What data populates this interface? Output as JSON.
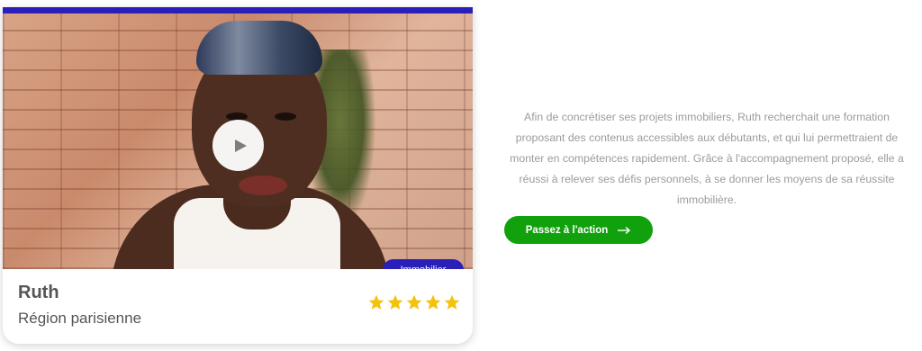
{
  "card": {
    "name": "Ruth",
    "region": "Région parisienne",
    "badge": "Immobilier",
    "rating": 5,
    "accent_color": "#2a1fb8",
    "star_color": "#f4c20d"
  },
  "video": {
    "play_icon": "play-icon"
  },
  "testimonial": {
    "text": "Afin de concrétiser ses projets immobiliers, Ruth recherchait une formation proposant des contenus accessibles aux débutants, et qui lui permettraient de monter en compétences rapidement. Grâce à l'accompagnement proposé, elle a réussi à relever ses défis personnels, à se donner les moyens de sa réussite immobilière."
  },
  "cta": {
    "label": "Passez à l'action",
    "icon": "arrow-right-icon",
    "color": "#11a10d"
  }
}
